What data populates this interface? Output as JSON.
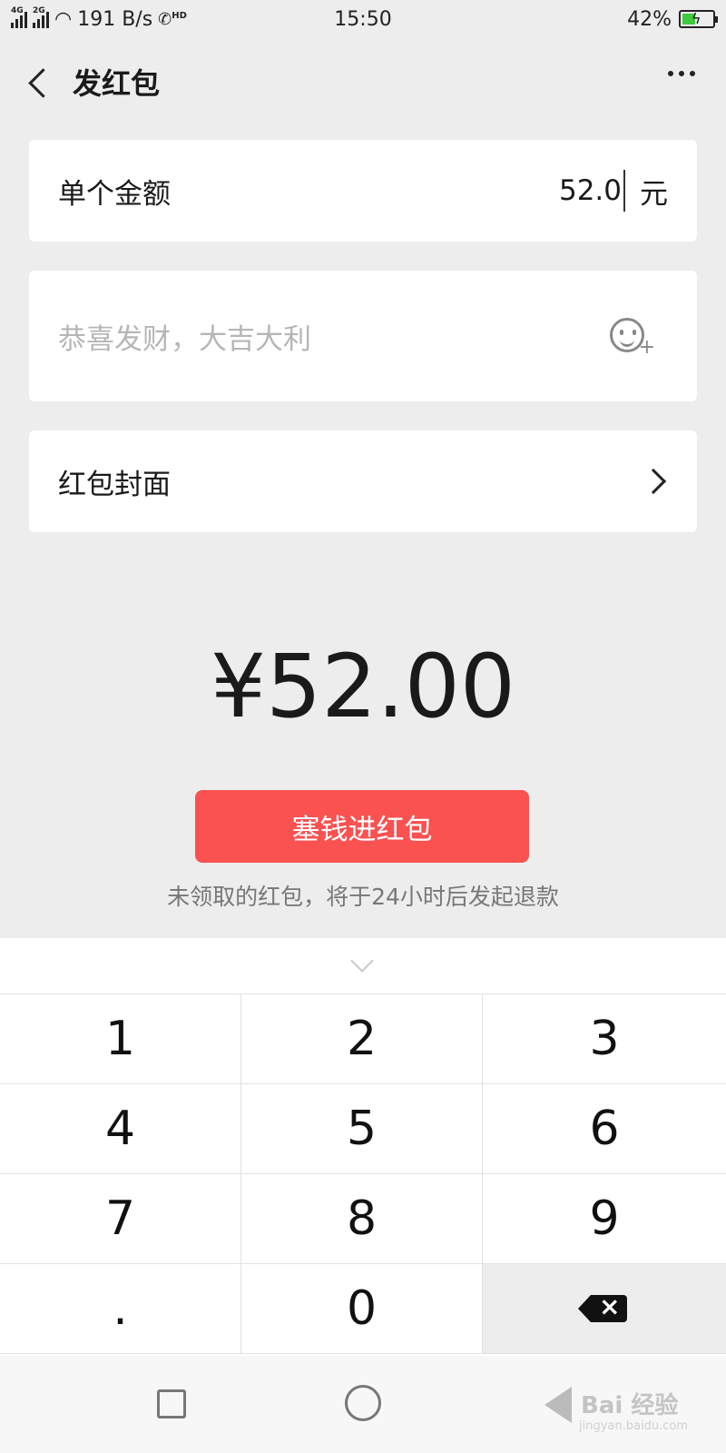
{
  "status_bar": {
    "net1": "4G",
    "net2": "2G",
    "speed": "191 B/s",
    "hd": "HD",
    "time": "15:50",
    "battery": "42%"
  },
  "header": {
    "title": "发红包"
  },
  "amount_row": {
    "label": "单个金额",
    "value": "52.0",
    "unit": "元"
  },
  "greeting": {
    "placeholder": "恭喜发财，大吉大利"
  },
  "cover_row": {
    "label": "红包封面"
  },
  "total": "¥52.00",
  "submit_label": "塞钱进红包",
  "refund_note": "未领取的红包，将于24小时后发起退款",
  "keypad": {
    "k1": "1",
    "k2": "2",
    "k3": "3",
    "k4": "4",
    "k5": "5",
    "k6": "6",
    "k7": "7",
    "k8": "8",
    "k9": "9",
    "kdot": ".",
    "k0": "0"
  },
  "watermark": {
    "brand": "Bai 经验",
    "url": "jingyan.baidu.com"
  }
}
